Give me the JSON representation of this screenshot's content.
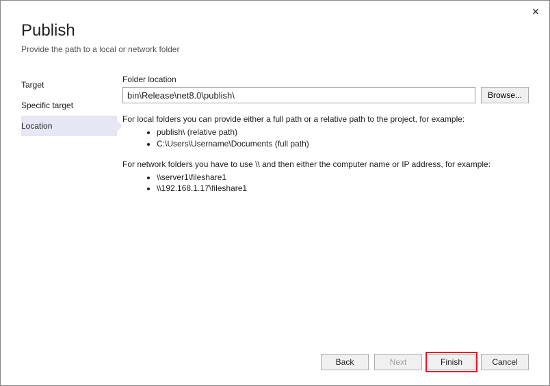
{
  "close_label": "✕",
  "header": {
    "title": "Publish",
    "subtitle": "Provide the path to a local or network folder"
  },
  "sidebar": {
    "items": [
      {
        "label": "Target",
        "selected": false
      },
      {
        "label": "Specific target",
        "selected": false
      },
      {
        "label": "Location",
        "selected": true
      }
    ]
  },
  "main": {
    "folder_label": "Folder location",
    "folder_value": "bin\\Release\\net8.0\\publish\\",
    "browse_label": "Browse...",
    "help_local_intro": "For local folders you can provide either a full path or a relative path to the project, for example:",
    "help_local_examples": [
      "publish\\ (relative path)",
      "C:\\Users\\Username\\Documents (full path)"
    ],
    "help_network_intro": "For network folders you have to use \\\\ and then either the computer name or IP address, for example:",
    "help_network_examples": [
      "\\\\server1\\fileshare1",
      "\\\\192.168.1.17\\fileshare1"
    ]
  },
  "footer": {
    "back": "Back",
    "next": "Next",
    "finish": "Finish",
    "cancel": "Cancel"
  }
}
